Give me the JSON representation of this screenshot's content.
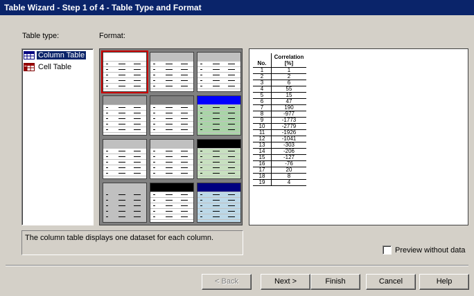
{
  "window": {
    "title": "Table Wizard - Step 1 of 4 - Table Type and Format"
  },
  "table_type": {
    "label": "Table type:",
    "items": [
      {
        "label": "Column Table",
        "selected": true,
        "icon": "column-table-icon"
      },
      {
        "label": "Cell Table",
        "selected": false,
        "icon": "cell-table-icon"
      }
    ]
  },
  "format": {
    "label": "Format:",
    "selected_index": 0,
    "styles": [
      {
        "header": "#ffffff",
        "body": "#ffffff"
      },
      {
        "header": "#c0c0c0",
        "body": "#ffffff"
      },
      {
        "header": "#c0c0c0",
        "body": "#ffffff"
      },
      {
        "header": "#a0a0a0",
        "body": "#ffffff"
      },
      {
        "header": "#808080",
        "body": "#ffffff"
      },
      {
        "header": "#0000ff",
        "body": "#aad4a8"
      },
      {
        "header": "#c0c0c0",
        "body": "#ffffff"
      },
      {
        "header": "#c0c0c0",
        "body": "#ffffff"
      },
      {
        "header": "#000000",
        "body": "#c8e0c0"
      },
      {
        "header": "#c0c0c0",
        "body": "#c0c0c0"
      },
      {
        "header": "#000000",
        "body": "#ffffff"
      },
      {
        "header": "#000080",
        "body": "#bcd8e8"
      }
    ]
  },
  "preview": {
    "col1": "No.",
    "col2": "Correlation",
    "col2_unit": "[%]",
    "rows": [
      [
        "1",
        "1"
      ],
      [
        "2",
        "2"
      ],
      [
        "3",
        "6"
      ],
      [
        "4",
        "55"
      ],
      [
        "5",
        "15"
      ],
      [
        "6",
        "47"
      ],
      [
        "7",
        "190"
      ],
      [
        "8",
        "-977"
      ],
      [
        "9",
        "-1773"
      ],
      [
        "10",
        "-2779"
      ],
      [
        "11",
        "-1926"
      ],
      [
        "12",
        "-1041"
      ],
      [
        "13",
        "-303"
      ],
      [
        "14",
        "-206"
      ],
      [
        "15",
        "-127"
      ],
      [
        "16",
        "-76"
      ],
      [
        "17",
        "20"
      ],
      [
        "18",
        "8"
      ],
      [
        "19",
        "4"
      ]
    ]
  },
  "description": "The column table displays one dataset for each column.",
  "preview_checkbox": {
    "label": "Preview without data",
    "checked": false
  },
  "buttons": {
    "back": "< Back",
    "next": "Next >",
    "finish": "Finish",
    "cancel": "Cancel",
    "help": "Help"
  }
}
